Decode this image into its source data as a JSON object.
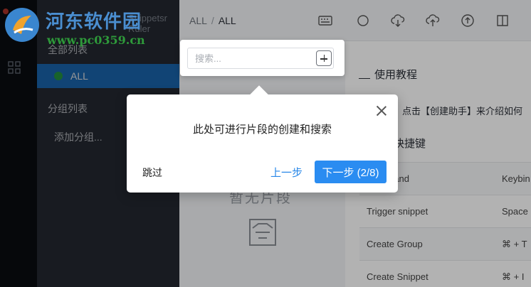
{
  "sidebar": {
    "app_name": "Snippetsr Ruler",
    "all_list_label": "全部列表",
    "active_item": "ALL",
    "group_list_label": "分组列表",
    "add_group_label": "添加分组..."
  },
  "header": {
    "breadcrumb_root": "ALL",
    "breadcrumb_sep": "/",
    "breadcrumb_current": "ALL"
  },
  "toolbar_icons": [
    "keyboard-icon",
    "circle-icon",
    "cloud-download-icon",
    "cloud-upload-icon",
    "arrow-up-icon",
    "book-icon"
  ],
  "empty_state": {
    "title": "暂无片段"
  },
  "tutorial": {
    "title": "使用教程",
    "text": "点击【创建助手】来介绍如何"
  },
  "keybindings": {
    "title": "快捷键",
    "rows": [
      {
        "command": "Command",
        "key": "Keybin"
      },
      {
        "command": "Trigger snippet",
        "key": "Space"
      },
      {
        "command": "Create Group",
        "key": "⌘ + T"
      },
      {
        "command": "Create Snippet",
        "key": "⌘ + I"
      }
    ]
  },
  "search": {
    "placeholder": "搜索..."
  },
  "tour": {
    "message": "此处可进行片段的创建和搜索",
    "skip_label": "跳过",
    "prev_label": "上一步",
    "next_label": "下一步 (2/8)"
  },
  "watermark": {
    "name": "河东软件园",
    "url": "www.pc0359.cn"
  },
  "colors": {
    "accent": "#2a8cf1",
    "sidebar_active": "#1e74c6",
    "sidebar_bg": "#2a2f38"
  }
}
